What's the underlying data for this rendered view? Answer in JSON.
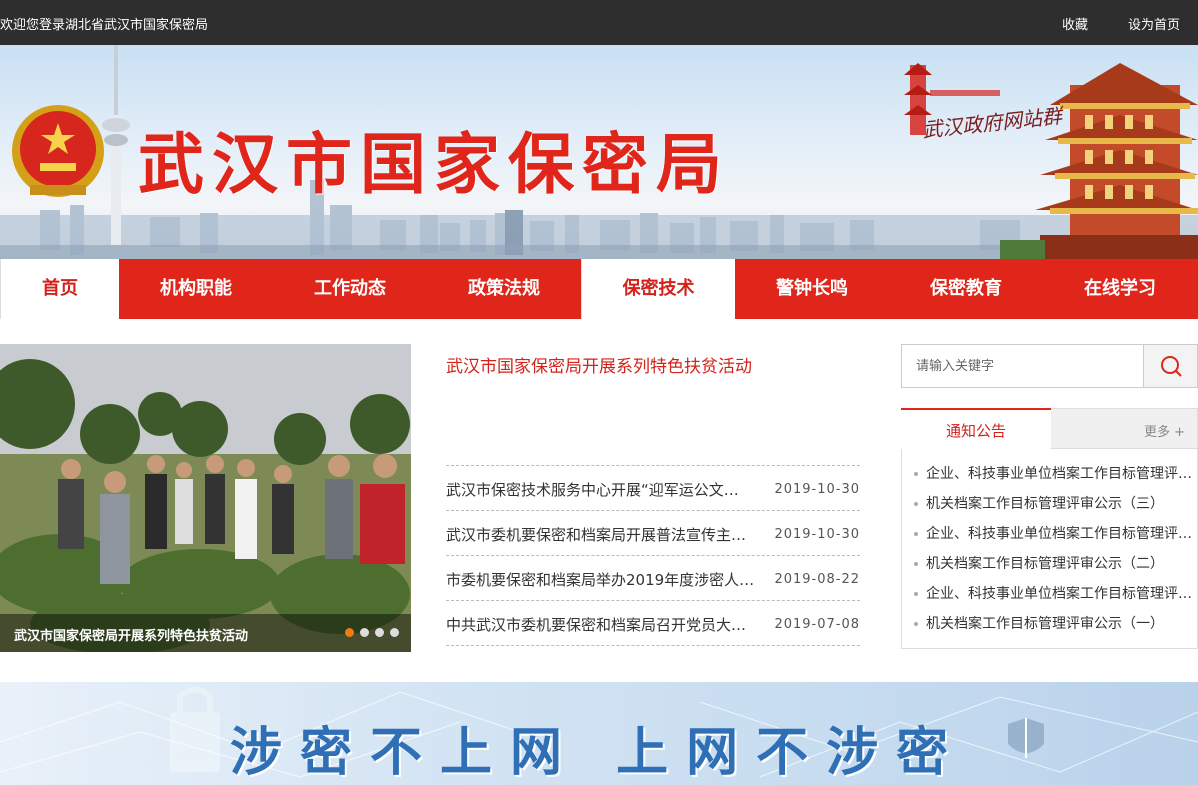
{
  "topbar": {
    "welcome": "欢迎您登录湖北省武汉市国家保密局",
    "favorite": "收藏",
    "set_home": "设为首页"
  },
  "banner": {
    "title": "武汉市国家保密局",
    "portal_signature": "武汉政府网站群"
  },
  "nav": {
    "items": [
      {
        "label": "首页"
      },
      {
        "label": "机构职能"
      },
      {
        "label": "工作动态"
      },
      {
        "label": "政策法规"
      },
      {
        "label": "保密技术"
      },
      {
        "label": "警钟长鸣"
      },
      {
        "label": "保密教育"
      },
      {
        "label": "在线学习"
      }
    ],
    "active": [
      "首页",
      "保密技术"
    ]
  },
  "slider": {
    "caption": "武汉市国家保密局开展系列特色扶贫活动",
    "dots": 4,
    "active_dot": 1
  },
  "news": {
    "headline": "武汉市国家保密局开展系列特色扶贫活动",
    "items": [
      {
        "title": "武汉市保密技术服务中心开展“迎军运公文…",
        "date": "2019-10-30"
      },
      {
        "title": "武汉市委机要保密和档案局开展普法宣传主…",
        "date": "2019-10-30"
      },
      {
        "title": "市委机要保密和档案局举办2019年度涉密人…",
        "date": "2019-08-22"
      },
      {
        "title": "中共武汉市委机要保密和档案局召开党员大…",
        "date": "2019-07-08"
      }
    ]
  },
  "search": {
    "placeholder": "请输入关键字"
  },
  "notice": {
    "tab": "通知公告",
    "more": "更多 +",
    "items": [
      "企业、科技事业单位档案工作目标管理评…",
      "机关档案工作目标管理评审公示（三）",
      "企业、科技事业单位档案工作目标管理评…",
      "机关档案工作目标管理评审公示（二）",
      "企业、科技事业单位档案工作目标管理评…",
      "机关档案工作目标管理评审公示（一）"
    ]
  },
  "slogan": {
    "text": "涉密不上网 上网不涉密"
  },
  "colors": {
    "brand_red": "#e0251b",
    "topbar_bg": "#2e2e2e",
    "slogan_blue": "#2f6fb5",
    "active_dot": "#f07c10"
  }
}
